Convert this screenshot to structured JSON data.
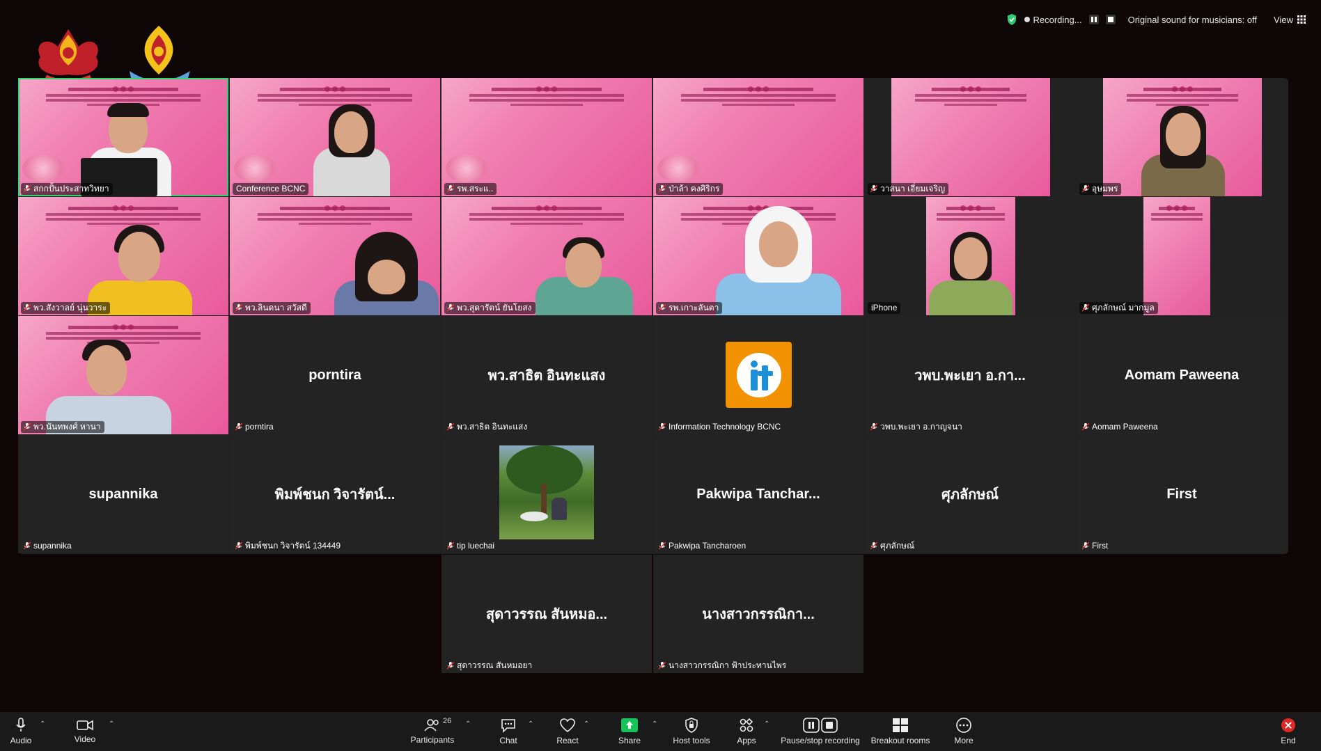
{
  "status": {
    "recording": "Recording...",
    "original_sound": "Original sound for musicians: off",
    "view": "View"
  },
  "tiles": [
    {
      "name": "สกกปั้นประสาทวิทยา",
      "kind": "video"
    },
    {
      "name": "Conference BCNC",
      "kind": "video"
    },
    {
      "name": "รพ.สระแ..",
      "kind": "video"
    },
    {
      "name": "ป่าล้า คงศิริกร",
      "kind": "video"
    },
    {
      "name": "วาสนา เอี่ยมเจริญ",
      "kind": "video"
    },
    {
      "name": "อุษมพร",
      "kind": "video"
    },
    {
      "name": "พว.สังวาลย์ นุ่นวาระ",
      "kind": "video"
    },
    {
      "name": "พว.ลินดนา สวัสดี",
      "kind": "video"
    },
    {
      "name": "พว.สุดารัตน์ ยันโยสง",
      "kind": "video"
    },
    {
      "name": "รพ.เกาะลันตา",
      "kind": "video"
    },
    {
      "name": "iPhone",
      "kind": "video"
    },
    {
      "name": "ศุภลักษณ์ มากมูล",
      "kind": "video"
    },
    {
      "name": "พว.นันทพงศ์ หานา",
      "kind": "video"
    },
    {
      "name": "porntira",
      "display": "porntira",
      "kind": "name"
    },
    {
      "name": "พว.สาธิต อินทะแสง",
      "display": "พว.สาธิต  อินทะแสง",
      "kind": "name"
    },
    {
      "name": "Information Technology BCNC",
      "kind": "logo",
      "logo_text": "iT",
      "logo_sub": "BCNC"
    },
    {
      "name": "วพบ.พะเยา อ.กาญจนา",
      "display": "วพบ.พะเยา อ.กา...",
      "kind": "name"
    },
    {
      "name": "Aomam Paweena",
      "display": "Aomam Paweena",
      "kind": "name"
    },
    {
      "name": "supannika",
      "display": "supannika",
      "kind": "name"
    },
    {
      "name": "พิมพ์ชนก วิจารัตน์ 134449",
      "display": "พิมพ์ชนก วิจารัตน์...",
      "kind": "name"
    },
    {
      "name": "tip luechai",
      "kind": "photo"
    },
    {
      "name": "Pakwipa Tancharoen",
      "display": "Pakwipa  Tanchar...",
      "kind": "name"
    },
    {
      "name": "ศุภลักษณ์",
      "display": "ศุภลักษณ์",
      "kind": "name"
    },
    {
      "name": "First",
      "display": "First",
      "kind": "name"
    },
    {
      "name": "สุดาวรรณ สันหมอยา",
      "display": "สุดาวรรณ  สันหมอ...",
      "kind": "name"
    },
    {
      "name": "นางสาวกรรณิกา ฟ้าประทานไพร",
      "display": "นางสาวกรรณิกา...",
      "kind": "name"
    }
  ],
  "toolbar": {
    "audio": "Audio",
    "video": "Video",
    "participants": "Participants",
    "participants_count": "26",
    "chat": "Chat",
    "react": "React",
    "share": "Share",
    "host_tools": "Host tools",
    "apps": "Apps",
    "pause_stop": "Pause/stop recording",
    "breakout": "Breakout rooms",
    "more": "More",
    "end": "End"
  },
  "colors": {
    "accent_green": "#2ed573",
    "share_green": "#18c35a",
    "end_red": "#e02828",
    "slide_pink": "#f07db0",
    "it_orange": "#f39200"
  }
}
